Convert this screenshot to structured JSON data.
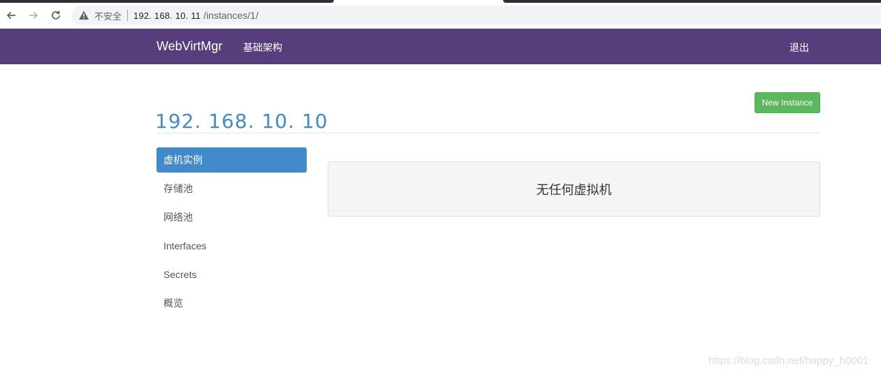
{
  "browser": {
    "security_label": "不安全",
    "url_host": "192. 168. 10. 11",
    "url_path": "/instances/1/"
  },
  "navbar": {
    "brand": "WebVirtMgr",
    "infrastructure_label": "基础架构",
    "logout_label": "退出",
    "color": "#563d7c"
  },
  "page": {
    "title": "192. 168. 10. 10",
    "new_instance_label": "New Instance"
  },
  "sidebar": {
    "items": [
      {
        "label": "虚机实例",
        "active": true
      },
      {
        "label": "存储池",
        "active": false
      },
      {
        "label": "网络池",
        "active": false
      },
      {
        "label": "Interfaces",
        "active": false
      },
      {
        "label": "Secrets",
        "active": false
      },
      {
        "label": "概览",
        "active": false
      }
    ]
  },
  "main": {
    "empty_message": "无任何虚拟机"
  },
  "watermark": "https://blog.csdn.net/happy_h0001"
}
